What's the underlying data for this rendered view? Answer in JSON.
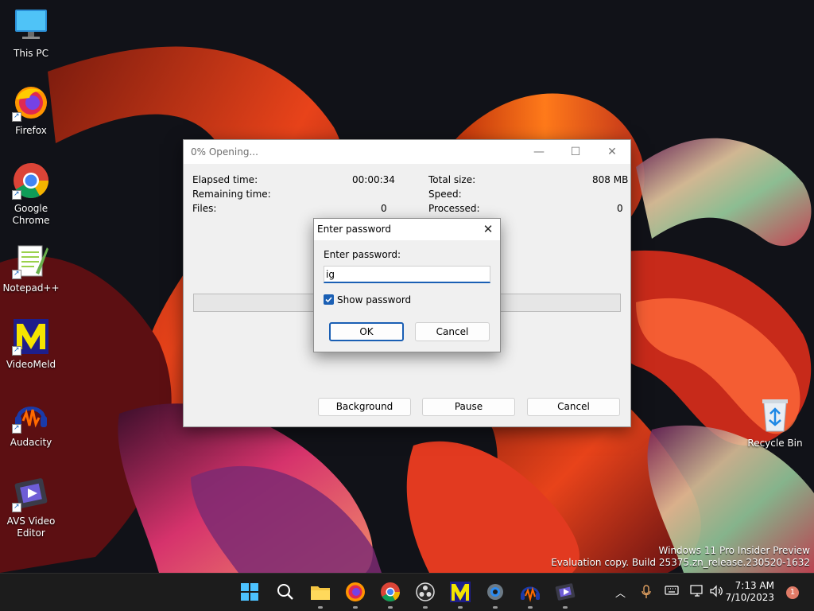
{
  "desktop": {
    "icons": [
      {
        "label_line1": "This PC",
        "label_line2": "",
        "icon": "monitor-icon"
      },
      {
        "label_line1": "Firefox",
        "label_line2": "",
        "icon": "firefox-icon"
      },
      {
        "label_line1": "Google",
        "label_line2": "Chrome",
        "icon": "chrome-icon"
      },
      {
        "label_line1": "Notepad++",
        "label_line2": "",
        "icon": "notepadpp-icon"
      },
      {
        "label_line1": "VideoMeld",
        "label_line2": "",
        "icon": "videomeld-icon"
      },
      {
        "label_line1": "Audacity",
        "label_line2": "",
        "icon": "audacity-icon"
      },
      {
        "label_line1": "AVS Video",
        "label_line2": "Editor",
        "icon": "avs-video-editor-icon"
      },
      {
        "label_line1": "Recycle Bin",
        "label_line2": "",
        "icon": "recycle-bin-icon"
      }
    ]
  },
  "progress_window": {
    "title": "0% Opening...",
    "elapsed_label": "Elapsed time:",
    "elapsed_value": "00:00:34",
    "remaining_label": "Remaining time:",
    "files_label": "Files:",
    "files_value": "0",
    "total_size_label": "Total size:",
    "total_size_value": "808 MB",
    "speed_label": "Speed:",
    "processed_label": "Processed:",
    "processed_value": "0",
    "progress_fraction": 0,
    "buttons": {
      "background": "Background",
      "pause": "Pause",
      "cancel": "Cancel"
    }
  },
  "password_dialog": {
    "title": "Enter password",
    "field_label": "Enter password:",
    "field_value": "ig",
    "show_password_label": "Show password",
    "show_password_checked": true,
    "ok_label": "OK",
    "cancel_label": "Cancel"
  },
  "watermark": {
    "line1": "Windows 11 Pro Insider Preview",
    "line2": "Evaluation copy. Build 25375.zn_release.230520-1632"
  },
  "taskbar": {
    "apps": [
      "start-icon",
      "search-icon",
      "file-explorer-icon",
      "firefox-icon",
      "chrome-icon",
      "obs-icon",
      "videomeld-icon",
      "settings-icon",
      "audacity-icon",
      "avs-video-editor-icon"
    ],
    "time": "7:13 AM",
    "date": "7/10/2023",
    "notification_count": "1"
  },
  "colors": {
    "accent": "#1a5fb4",
    "taskbar": "#1c1c1c",
    "notification_badge": "#e07b67"
  }
}
